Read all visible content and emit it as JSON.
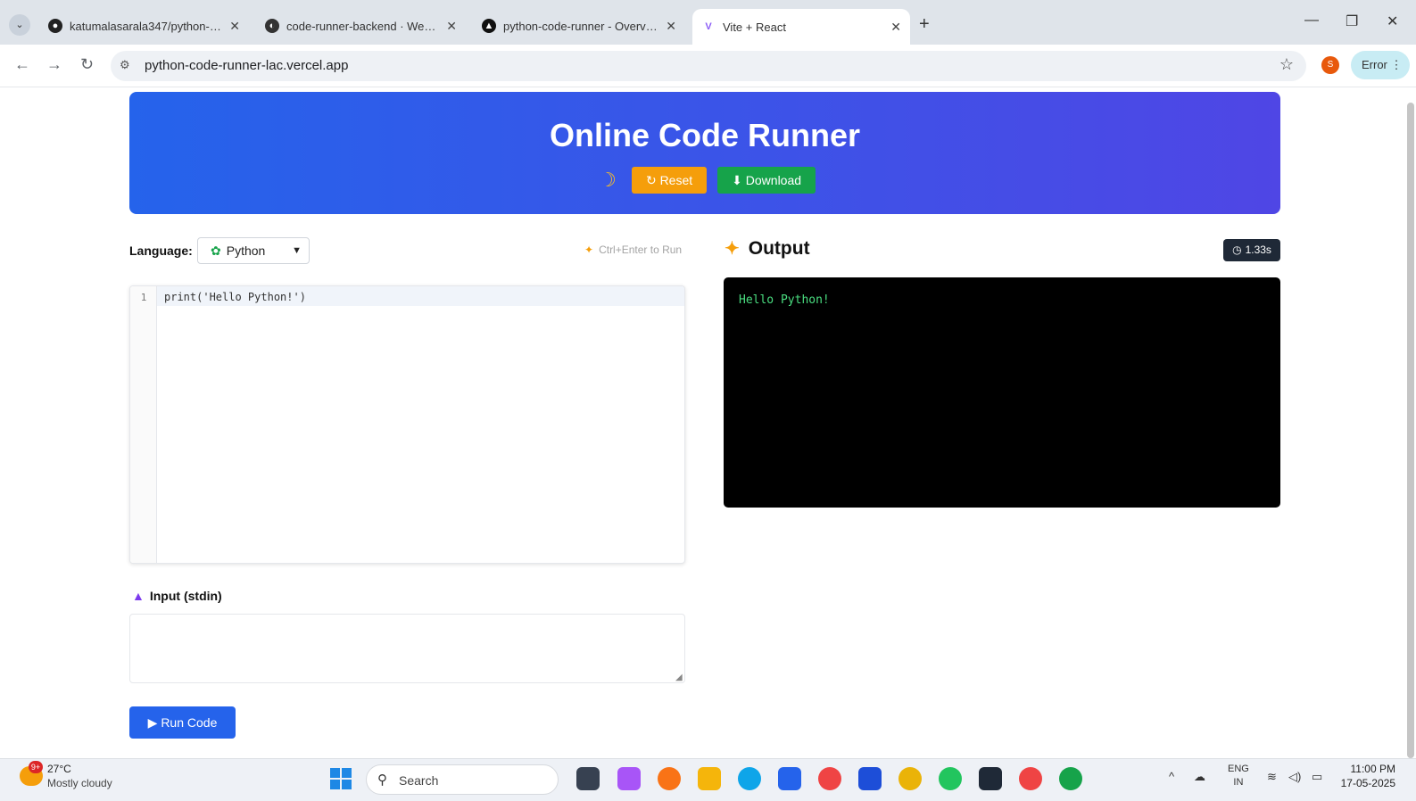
{
  "browser": {
    "tabs": [
      {
        "label": "katumalasarala347/python-cod",
        "icon": "github-icon"
      },
      {
        "label": "code-runner-backend · Web S",
        "icon": "render-icon"
      },
      {
        "label": "python-code-runner - Overview",
        "icon": "vercel-icon"
      },
      {
        "label": "Vite + React",
        "icon": "vite-icon",
        "active": true
      }
    ],
    "url": "python-code-runner-lac.vercel.app",
    "profile_initial": "S",
    "error_label": "Error"
  },
  "app": {
    "title": "Online Code Runner",
    "reset_label": "↻ Reset",
    "download_label": "⬇ Download",
    "language_label": "Language:",
    "language_value": "Python",
    "shortcut_hint": "Ctrl+Enter to Run",
    "editor": {
      "line_number": "1",
      "code": "print('Hello Python!')"
    },
    "output_title": "Output",
    "exec_time": "1.33s",
    "output_text": "Hello Python!",
    "stdin_label": "Input (stdin)",
    "stdin_value": "",
    "run_label": "Run Code"
  },
  "taskbar": {
    "weather_temp": "27°C",
    "weather_desc": "Mostly cloudy",
    "weather_badge": "9+",
    "search_placeholder": "Search",
    "lang_line1": "ENG",
    "lang_line2": "IN",
    "time": "11:00 PM",
    "date": "17-05-2025"
  },
  "colors": {
    "hero_start": "#2563eb",
    "hero_end": "#4f46e5",
    "reset": "#f59e0b",
    "download": "#16a34a",
    "run": "#2563eb",
    "output_bg": "#000000",
    "output_text": "#4ade80"
  }
}
